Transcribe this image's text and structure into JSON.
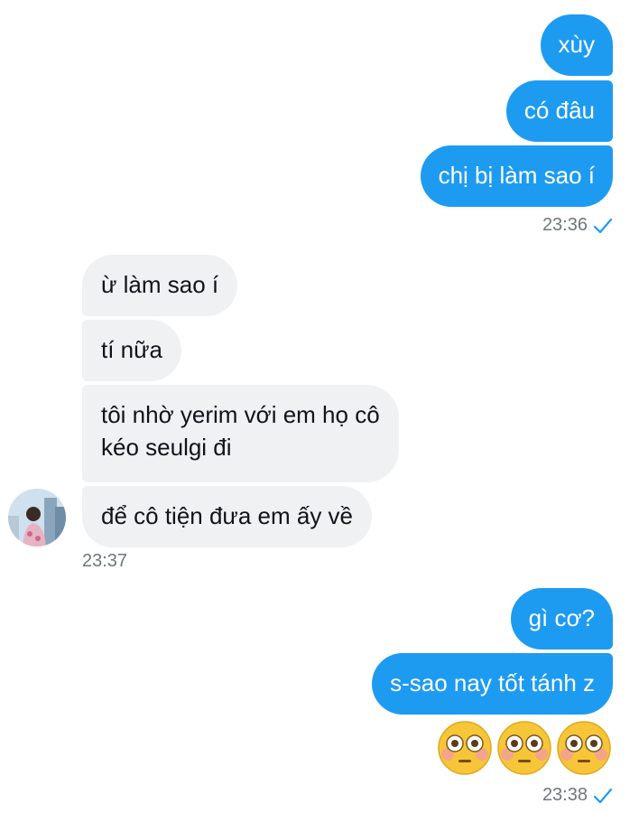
{
  "colors": {
    "outgoing_bubble": "#1d9bf0",
    "incoming_bubble": "#eff1f3",
    "timestamp": "#6e767d",
    "read_check": "#1d9bf0"
  },
  "messages": {
    "group1_sent": [
      "xùy",
      "có đâu",
      "chị bị làm sao í"
    ],
    "group1_time": "23:36",
    "group2_received": [
      "ừ làm sao í",
      "tí nữa",
      "tôi nhờ yerim với em họ cô",
      "kéo seulgi đi",
      "để cô tiện đưa em ấy về"
    ],
    "group2_time": "23:37",
    "group3_sent": [
      "gì cơ?",
      "s-sao nay tốt tánh z"
    ],
    "group3_emoji": "flushed-face-emoji x3",
    "group3_time": "23:38"
  },
  "icons": {
    "read_receipt": "check-icon",
    "avatar": "user-avatar",
    "emoji": "flushed-face-emoji"
  }
}
